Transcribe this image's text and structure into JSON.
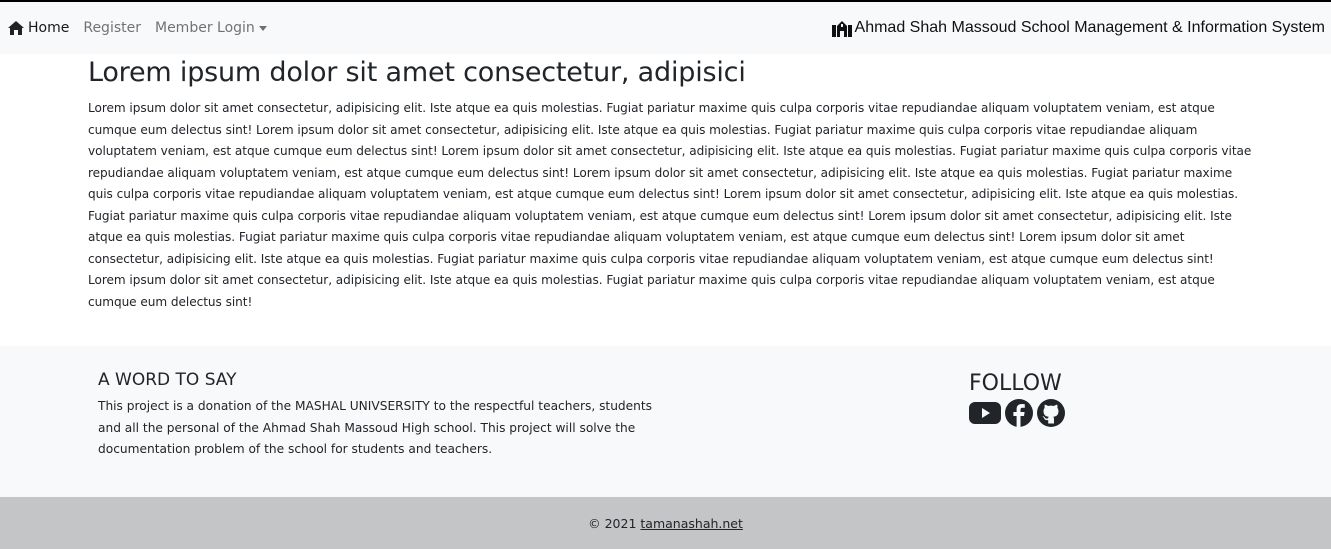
{
  "nav": {
    "home_label": "Home",
    "register_label": "Register",
    "member_login_label": "Member Login",
    "brand": "Ahmad Shah Massoud School Management & Information System"
  },
  "main": {
    "title": "Lorem ipsum dolor sit amet consectetur, adipisici",
    "paragraph": "Lorem ipsum dolor sit amet consectetur, adipisicing elit. Iste atque ea quis molestias. Fugiat pariatur maxime quis culpa corporis vitae repudiandae aliquam voluptatem veniam, est atque cumque eum delectus sint! Lorem ipsum dolor sit amet consectetur, adipisicing elit. Iste atque ea quis molestias. Fugiat pariatur maxime quis culpa corporis vitae repudiandae aliquam voluptatem veniam, est atque cumque eum delectus sint! Lorem ipsum dolor sit amet consectetur, adipisicing elit. Iste atque ea quis molestias. Fugiat pariatur maxime quis culpa corporis vitae repudiandae aliquam voluptatem veniam, est atque cumque eum delectus sint! Lorem ipsum dolor sit amet consectetur, adipisicing elit. Iste atque ea quis molestias. Fugiat pariatur maxime quis culpa corporis vitae repudiandae aliquam voluptatem veniam, est atque cumque eum delectus sint! Lorem ipsum dolor sit amet consectetur, adipisicing elit. Iste atque ea quis molestias. Fugiat pariatur maxime quis culpa corporis vitae repudiandae aliquam voluptatem veniam, est atque cumque eum delectus sint! Lorem ipsum dolor sit amet consectetur, adipisicing elit. Iste atque ea quis molestias. Fugiat pariatur maxime quis culpa corporis vitae repudiandae aliquam voluptatem veniam, est atque cumque eum delectus sint! Lorem ipsum dolor sit amet consectetur, adipisicing elit. Iste atque ea quis molestias. Fugiat pariatur maxime quis culpa corporis vitae repudiandae aliquam voluptatem veniam, est atque cumque eum delectus sint! Lorem ipsum dolor sit amet consectetur, adipisicing elit. Iste atque ea quis molestias. Fugiat pariatur maxime quis culpa corporis vitae repudiandae aliquam voluptatem veniam, est atque cumque eum delectus sint!"
  },
  "footer_top": {
    "word_title": "A WORD TO SAY",
    "word_text": "This project is a donation of the MASHAL UNIVSERSITY to the respectful teachers, students and all the personal of the Ahmad Shah Massoud High school. This project will solve the documentation problem of the school for students and teachers.",
    "follow_title": "FOLLOW",
    "social_icons": [
      "youtube-icon",
      "facebook-icon",
      "github-icon"
    ]
  },
  "footer": {
    "copyright_prefix": "© 2021",
    "link_text": "tamanashah.net"
  }
}
